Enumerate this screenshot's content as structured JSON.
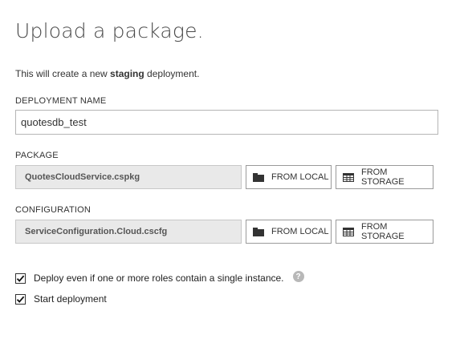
{
  "title": "Upload a package.",
  "subtitle": {
    "before": "This will create a new ",
    "emphasis": "staging",
    "after": " deployment."
  },
  "deployment_name": {
    "label": "DEPLOYMENT NAME",
    "value": "quotesdb_test"
  },
  "package": {
    "label": "PACKAGE",
    "file": "QuotesCloudService.cspkg",
    "from_local_label": "FROM LOCAL",
    "from_storage_label": "FROM STORAGE"
  },
  "configuration": {
    "label": "CONFIGURATION",
    "file": "ServiceConfiguration.Cloud.cscfg",
    "from_local_label": "FROM LOCAL",
    "from_storage_label": "FROM STORAGE"
  },
  "options": [
    {
      "label": "Deploy even if one or more roles contain a single instance.",
      "checked": true,
      "help_icon": "question-circle-icon"
    },
    {
      "label": "Start deployment",
      "checked": true
    }
  ],
  "help_glyph": "?"
}
